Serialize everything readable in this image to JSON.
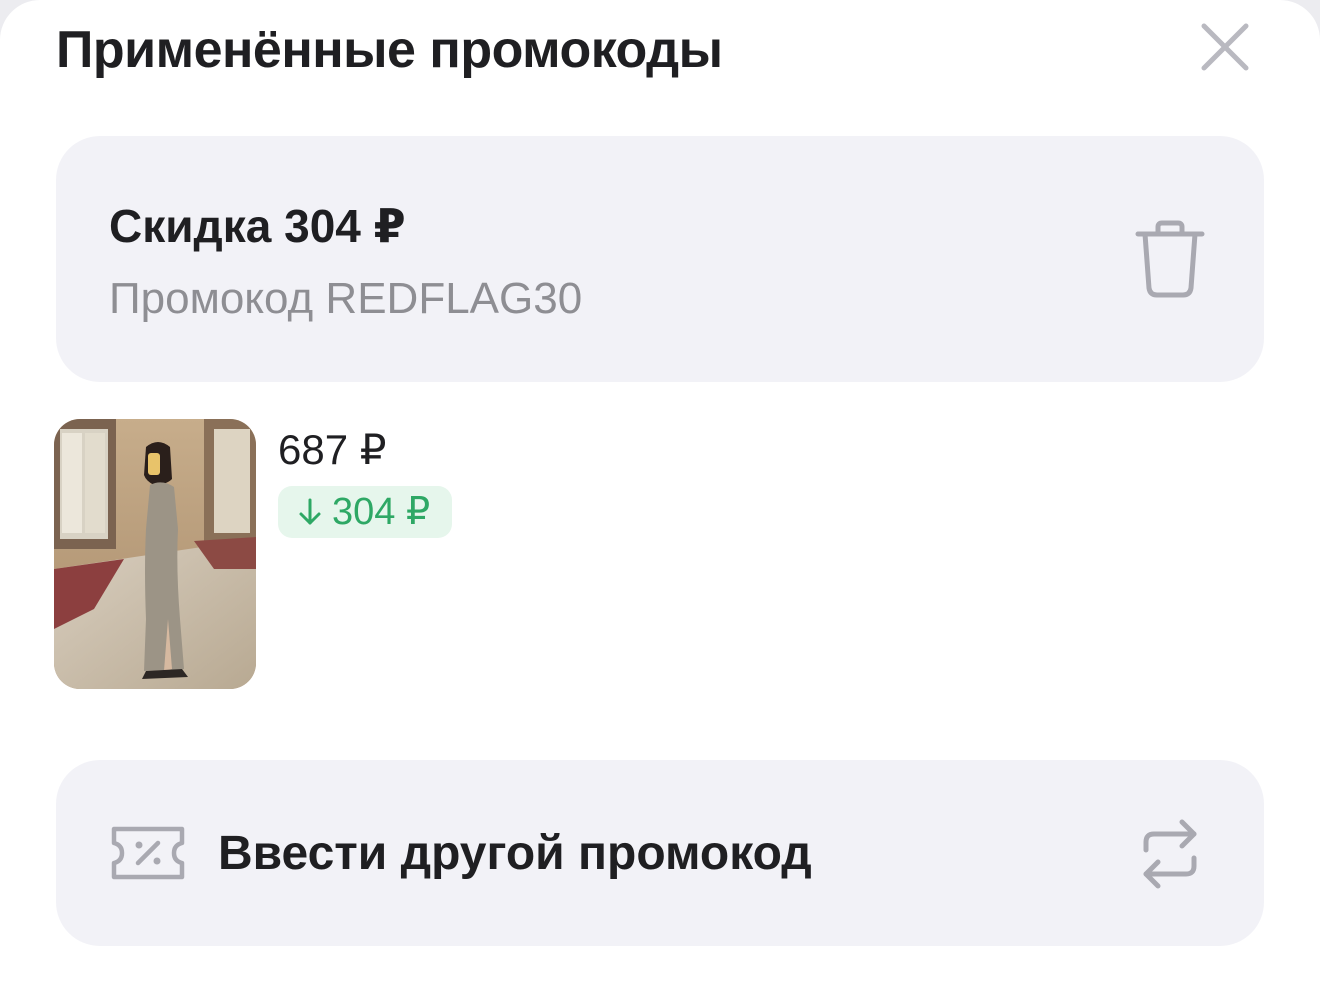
{
  "header": {
    "title": "Применённые промокоды",
    "close_icon": "close-icon"
  },
  "applied_promo": {
    "discount": "Скидка 304 ₽",
    "code_label": "Промокод REDFLAG30",
    "delete_icon": "trash-icon"
  },
  "product": {
    "image_alt": "dress-photo",
    "price": "687 ₽",
    "discount_badge": "304 ₽",
    "discount_icon": "arrow-down-icon"
  },
  "enter_other": {
    "label": "Ввести другой промокод",
    "left_icon": "coupon-icon",
    "right_icon": "swap-icon"
  },
  "colors": {
    "text": "#1f1f22",
    "secondary_text": "#8e8e93",
    "card_bg": "#f2f2f7",
    "discount_green": "#2ea865",
    "discount_bg": "#e6f6ec"
  }
}
